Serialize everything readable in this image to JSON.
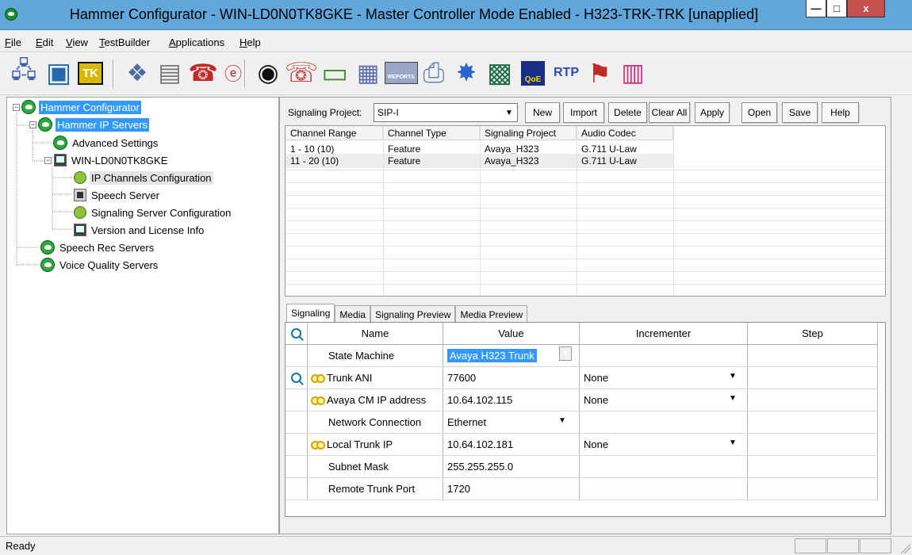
{
  "window": {
    "title": "Hammer Configurator - WIN-LD0N0TK8GKE - Master Controller Mode Enabled - H323-TRK-TRK [unapplied]",
    "controls": {
      "minimize": "—",
      "maximize": "□",
      "close": "x"
    }
  },
  "menu": {
    "items": [
      {
        "label": "File"
      },
      {
        "label": "Edit"
      },
      {
        "label": "View"
      },
      {
        "label": "TestBuilder"
      },
      {
        "label": "Applications"
      },
      {
        "label": "Help"
      }
    ]
  },
  "toolbar": {
    "icons": [
      {
        "name": "network-computer-icon",
        "glyph": "🖧",
        "color": "#3d5fa8"
      },
      {
        "name": "monitor-icon",
        "glyph": "▣",
        "color": "#2468b0"
      },
      {
        "name": "tk-icon",
        "glyph": "TK",
        "color": "#d8b800"
      },
      {
        "name": "diamond-network-icon",
        "glyph": "❖",
        "color": "#4c6ca0"
      },
      {
        "name": "document-icon",
        "glyph": "▤",
        "color": "#d4d4d4"
      },
      {
        "name": "phone-book-icon",
        "glyph": "☎",
        "color": "#c22a2a"
      },
      {
        "name": "e-icon",
        "glyph": "ⓔ",
        "color": "#c22a2a"
      },
      {
        "name": "hammer-logo-icon",
        "glyph": "◉",
        "color": "#111111"
      },
      {
        "name": "red-phone-icon",
        "glyph": "☏",
        "color": "#c22a2a"
      },
      {
        "name": "desktop-icon",
        "glyph": "▭",
        "color": "#4a8e37"
      },
      {
        "name": "panel-icon",
        "glyph": "▦",
        "color": "#5c6cb0"
      },
      {
        "name": "reports-icon",
        "glyph": "REPORTS",
        "color": "#9aa6c7"
      },
      {
        "name": "printer-icon",
        "glyph": "⎙",
        "color": "#6c7db0"
      },
      {
        "name": "star-network-icon",
        "glyph": "✸",
        "color": "#2a65d0"
      },
      {
        "name": "chart-monitor-icon",
        "glyph": "▩",
        "color": "#1d6d44"
      },
      {
        "name": "qoe-icon",
        "glyph": "QoE",
        "color": "#d8b800"
      },
      {
        "name": "rtp-icon",
        "glyph": "RTP",
        "color": "#2b4bb7"
      },
      {
        "name": "flag-icon",
        "glyph": "⚑",
        "color": "#c22a2a"
      },
      {
        "name": "chart-icon",
        "glyph": "▥",
        "color": "#c82f7a"
      }
    ]
  },
  "tree": {
    "items": [
      {
        "label": "Hammer Configurator",
        "selected": true
      },
      {
        "label": "Hammer IP Servers",
        "selected": true
      },
      {
        "label": "Advanced Settings"
      },
      {
        "label": "WIN-LD0N0TK8GKE"
      },
      {
        "label": "IP Channels Configuration"
      },
      {
        "label": "Speech Server"
      },
      {
        "label": "Signaling Server Configuration"
      },
      {
        "label": "Version and License Info"
      },
      {
        "label": "Speech Rec Servers"
      },
      {
        "label": "Voice Quality Servers"
      }
    ]
  },
  "config": {
    "signaling_project_label": "Signaling Project:",
    "signaling_project_value": "SIP-I",
    "buttons": [
      "New",
      "Import",
      "Delete",
      "Clear All",
      "Apply",
      "Open",
      "Save",
      "Help"
    ],
    "channel_columns": [
      "Channel Range",
      "Channel Type",
      "Signaling Project",
      "Audio Codec"
    ],
    "channel_rows": [
      [
        "1 - 10 (10)",
        "Feature",
        "Avaya_H323",
        "G.711 U-Law"
      ],
      [
        "11 - 20 (10)",
        "Feature",
        "Avaya_H323",
        "G.711 U-Law"
      ]
    ]
  },
  "tabs": [
    {
      "label": "Signaling",
      "active": true
    },
    {
      "label": "Media"
    },
    {
      "label": "Signaling Preview"
    },
    {
      "label": "Media Preview"
    }
  ],
  "properties": {
    "columns": [
      "",
      "Name",
      "Value",
      "Incrementer",
      "Step"
    ],
    "rows": [
      {
        "name": "State Machine",
        "value": "Avaya H323 Trunk",
        "incrementer": "",
        "step": ""
      },
      {
        "name": "Trunk ANI",
        "value": "77600",
        "incrementer": "None",
        "step": ""
      },
      {
        "name": "Avaya CM IP address",
        "value": "10.64.102.115",
        "incrementer": "None",
        "step": ""
      },
      {
        "name": "Network Connection",
        "value": "Ethernet",
        "incrementer": "",
        "step": ""
      },
      {
        "name": "Local Trunk IP",
        "value": "10.64.102.181",
        "incrementer": "None",
        "step": ""
      },
      {
        "name": "Subnet Mask",
        "value": "255.255.255.0",
        "incrementer": "",
        "step": ""
      },
      {
        "name": "Remote Trunk Port",
        "value": "1720",
        "incrementer": "",
        "step": ""
      }
    ]
  },
  "status": {
    "text": "Ready"
  }
}
